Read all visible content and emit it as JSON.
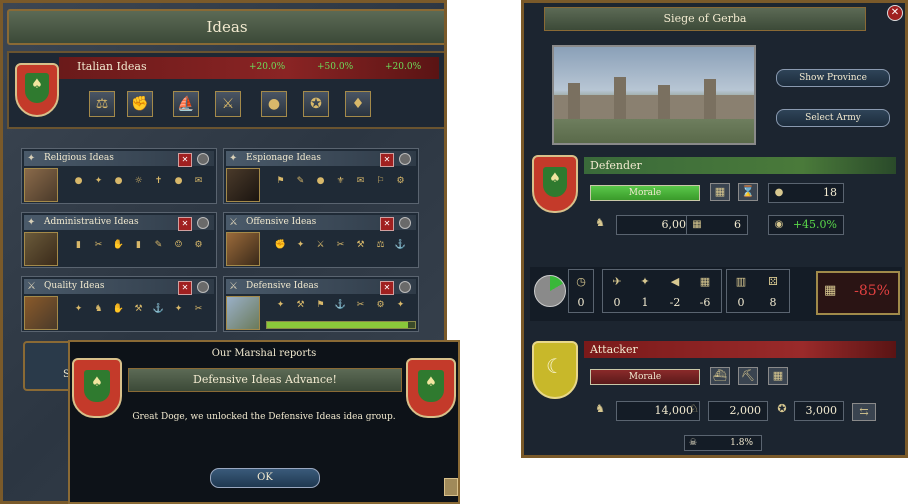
{
  "ideas": {
    "title": "Ideas",
    "national": {
      "name": "Italian Ideas",
      "bonuses": [
        "+20.0%",
        "+50.0%",
        "+20.0%"
      ],
      "idea_icons": [
        "scales-icon",
        "laborer-icon",
        "ships-icon",
        "soldiers-icon",
        "coins-icon",
        "medal-icon",
        "treasure-icon"
      ]
    },
    "groups": [
      {
        "name": "Religious Ideas"
      },
      {
        "name": "Espionage Ideas"
      },
      {
        "name": "Administrative Ideas"
      },
      {
        "name": "Offensive Ideas"
      },
      {
        "name": "Quality Ideas"
      },
      {
        "name": "Defensive Ideas",
        "progress": 0.95
      }
    ],
    "bottom_button_label": "Se"
  },
  "popup": {
    "header": "Our Marshal reports",
    "title": "Defensive Ideas Advance!",
    "body": "Great Doge, we unlocked the Defensive Ideas idea group.",
    "ok_label": "OK"
  },
  "siege": {
    "title": "Siege of Gerba",
    "show_province_label": "Show Province",
    "select_army_label": "Select Army",
    "defender": {
      "label": "Defender",
      "morale_label": "Morale",
      "morale_fraction": 1.0,
      "fort_level": "18",
      "troops": "6,000",
      "garrison": "6",
      "defense_bonus": "+45.0%"
    },
    "modifiers": [
      "0",
      "0",
      "1",
      "-2",
      "-6",
      "0",
      "8"
    ],
    "result": "-85%",
    "attacker": {
      "label": "Attacker",
      "morale_label": "Morale",
      "morale_fraction": 0.0,
      "infantry": "14,000",
      "cavalry": "2,000",
      "artillery": "3,000",
      "attrition": "1.8%"
    }
  }
}
